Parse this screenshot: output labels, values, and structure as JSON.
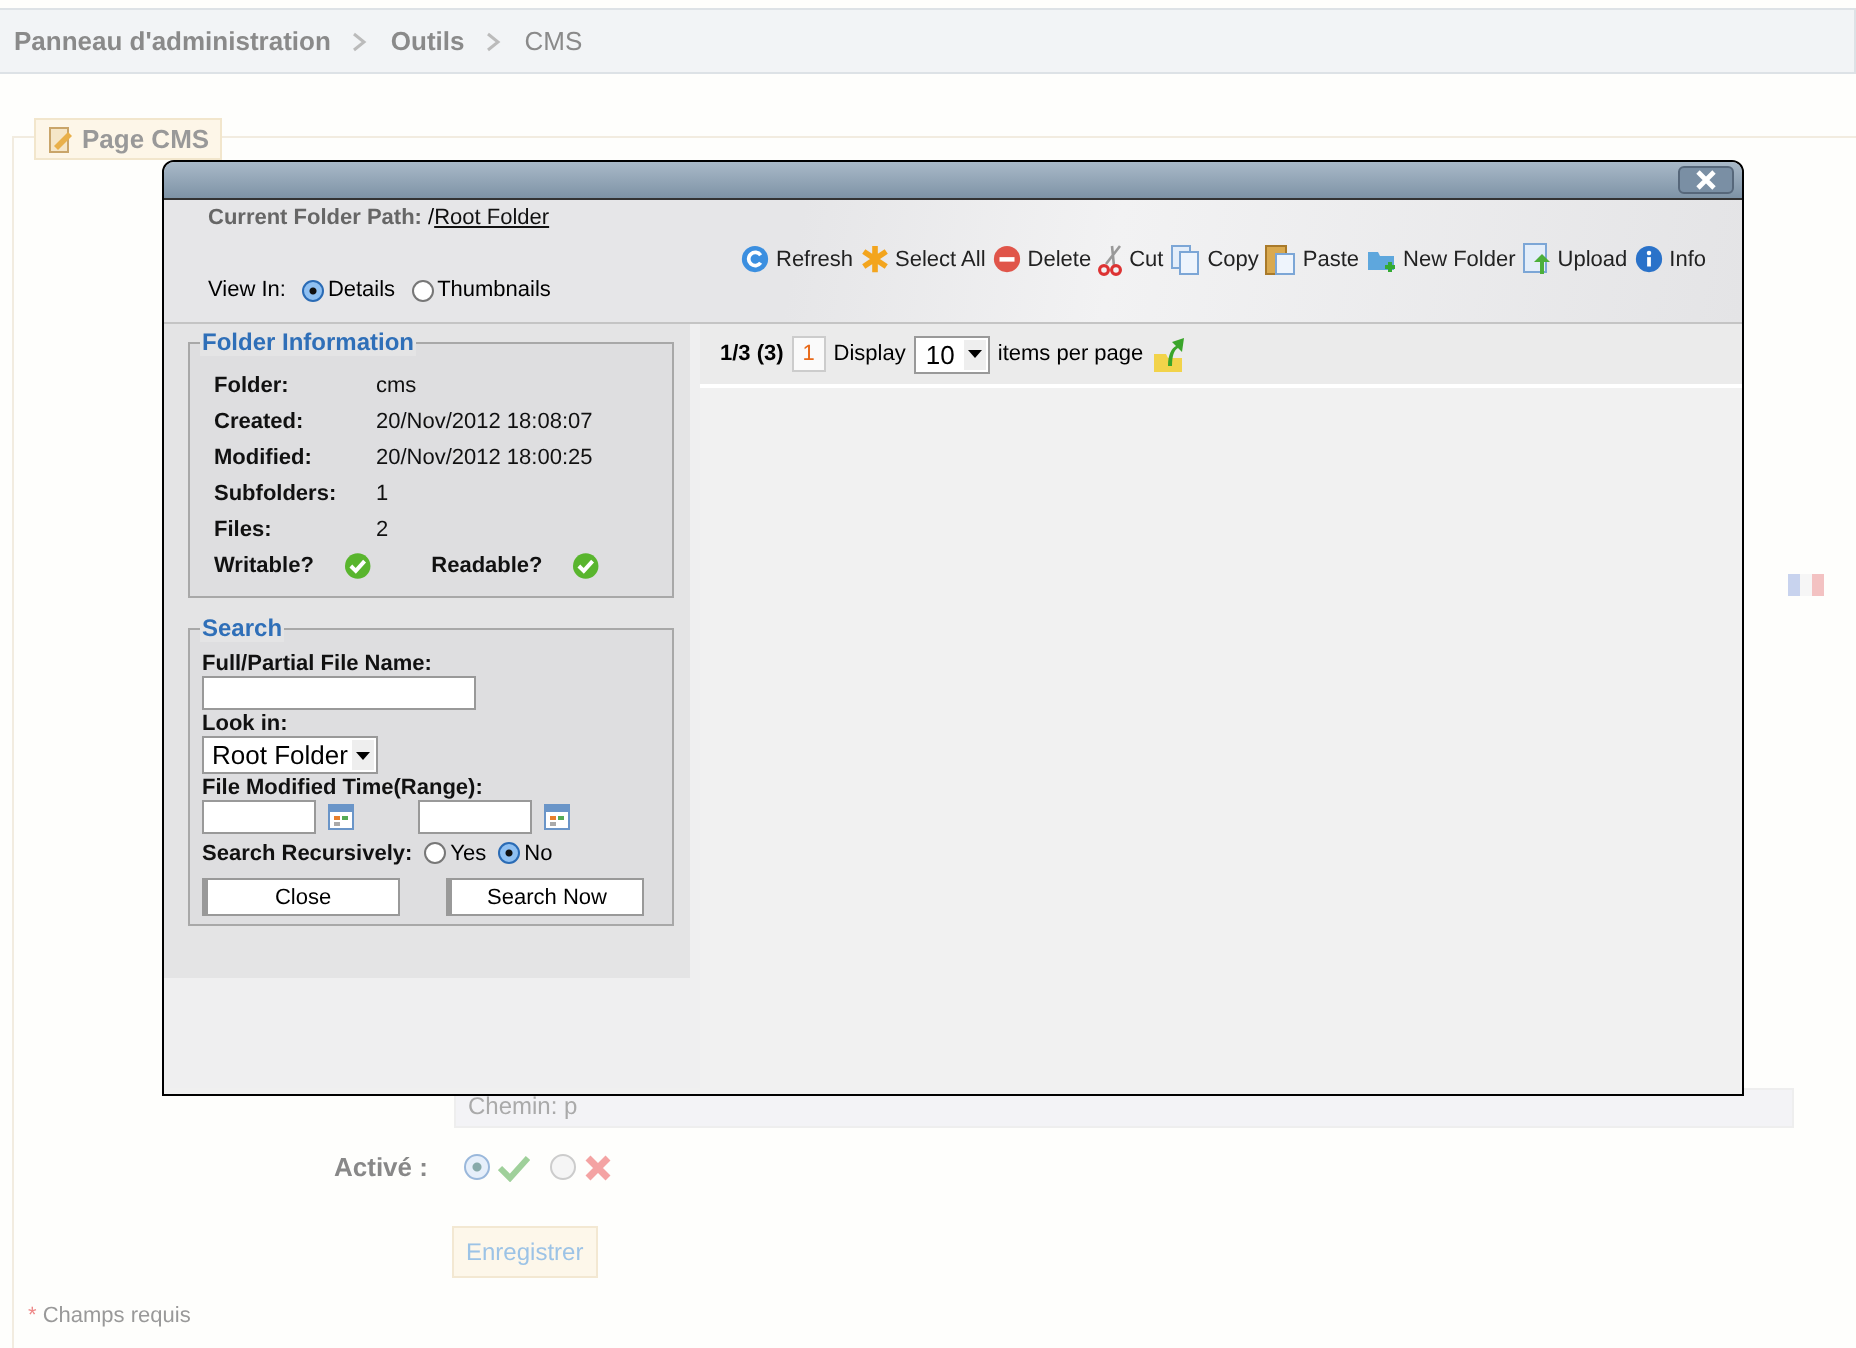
{
  "breadcrumb": [
    "Panneau d'administration",
    "Outils",
    "CMS"
  ],
  "legend": "Page CMS",
  "form": {
    "path_field": "Chemin: p",
    "active_label": "Activé :",
    "active_options": [
      {
        "kind": "yes",
        "selected": true
      },
      {
        "kind": "no",
        "selected": false
      }
    ],
    "save_button": "Enregistrer",
    "required_mark": "*",
    "required_note": "Champs requis"
  },
  "dialog": {
    "path_label": "Current Folder Path:",
    "path_prefix": "/",
    "path_link": "Root Folder",
    "view_label": "View In:",
    "view_options": [
      {
        "label": "Details",
        "selected": true
      },
      {
        "label": "Thumbnails",
        "selected": false
      }
    ],
    "toolbar": [
      {
        "kind": "refresh",
        "label": "Refresh"
      },
      {
        "kind": "select-all",
        "label": "Select All"
      },
      {
        "kind": "delete",
        "label": "Delete"
      },
      {
        "kind": "cut",
        "label": "Cut"
      },
      {
        "kind": "copy",
        "label": "Copy"
      },
      {
        "kind": "paste",
        "label": "Paste"
      },
      {
        "kind": "new-folder",
        "label": "New Folder"
      },
      {
        "kind": "upload",
        "label": "Upload"
      },
      {
        "kind": "info",
        "label": "Info"
      }
    ],
    "folder_info": {
      "title": "Folder Information",
      "rows": [
        {
          "label": "Folder:",
          "value": "cms"
        },
        {
          "label": "Created:",
          "value": "20/Nov/2012 18:08:07"
        },
        {
          "label": "Modified:",
          "value": "20/Nov/2012 18:00:25"
        },
        {
          "label": "Subfolders:",
          "value": "1"
        },
        {
          "label": "Files:",
          "value": "2"
        }
      ],
      "flags": [
        {
          "label": "Writable?",
          "ok": true
        },
        {
          "label": "Readable?",
          "ok": true
        }
      ]
    },
    "search": {
      "title": "Search",
      "name_label": "Full/Partial File Name:",
      "look_in_label": "Look in:",
      "look_in_value": "Root Folder",
      "time_label": "File Modified Time(Range):",
      "recursive_label": "Search Recursively:",
      "recursive_options": [
        {
          "label": "Yes",
          "selected": false
        },
        {
          "label": "No",
          "selected": true
        }
      ],
      "buttons": [
        "Close",
        "Search Now"
      ]
    },
    "pager": {
      "position": "1/3 (3)",
      "page": "1",
      "display_label": "Display",
      "per_page": "10",
      "per_page_label": "items per page"
    }
  }
}
